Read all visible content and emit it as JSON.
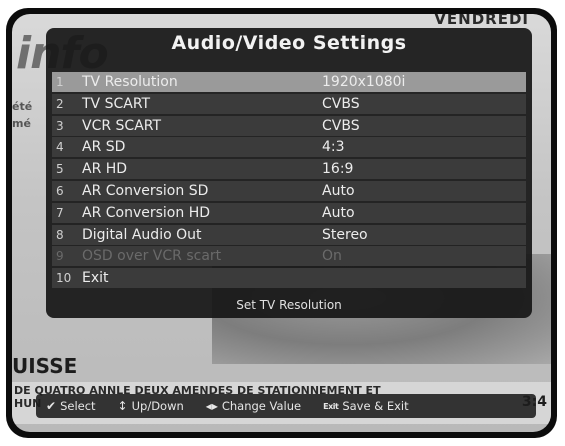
{
  "background": {
    "day": "VENDREDI",
    "logo": "info",
    "side_line_1": "été",
    "side_line_2": "mé",
    "region": "UISSE",
    "ticker_line_1": "DE QUATRO ANNLE DEUX AMENDES DE STATIONNEMENT ET",
    "ticker_line_2": "HUN",
    "clock": "3:4"
  },
  "osd": {
    "title": "Audio/Video Settings",
    "rows": [
      {
        "num": "1",
        "label": "TV Resolution",
        "value": "1920x1080i",
        "selected": true,
        "disabled": false
      },
      {
        "num": "2",
        "label": "TV SCART",
        "value": "CVBS",
        "selected": false,
        "disabled": false
      },
      {
        "num": "3",
        "label": "VCR SCART",
        "value": "CVBS",
        "selected": false,
        "disabled": false
      },
      {
        "num": "4",
        "label": "AR SD",
        "value": "4:3",
        "selected": false,
        "disabled": false
      },
      {
        "num": "5",
        "label": "AR HD",
        "value": "16:9",
        "selected": false,
        "disabled": false
      },
      {
        "num": "6",
        "label": "AR Conversion SD",
        "value": "Auto",
        "selected": false,
        "disabled": false
      },
      {
        "num": "7",
        "label": "AR Conversion HD",
        "value": "Auto",
        "selected": false,
        "disabled": false
      },
      {
        "num": "8",
        "label": "Digital Audio Out",
        "value": "Stereo",
        "selected": false,
        "disabled": false
      },
      {
        "num": "9",
        "label": "OSD over VCR scart",
        "value": "On",
        "selected": false,
        "disabled": true
      },
      {
        "num": "10",
        "label": "Exit",
        "value": "",
        "selected": false,
        "disabled": false
      }
    ],
    "hint": "Set TV Resolution"
  },
  "help": {
    "select": "Select",
    "updown": "Up/Down",
    "change": "Change Value",
    "exit_badge": "Exit",
    "save_exit": "Save & Exit"
  }
}
